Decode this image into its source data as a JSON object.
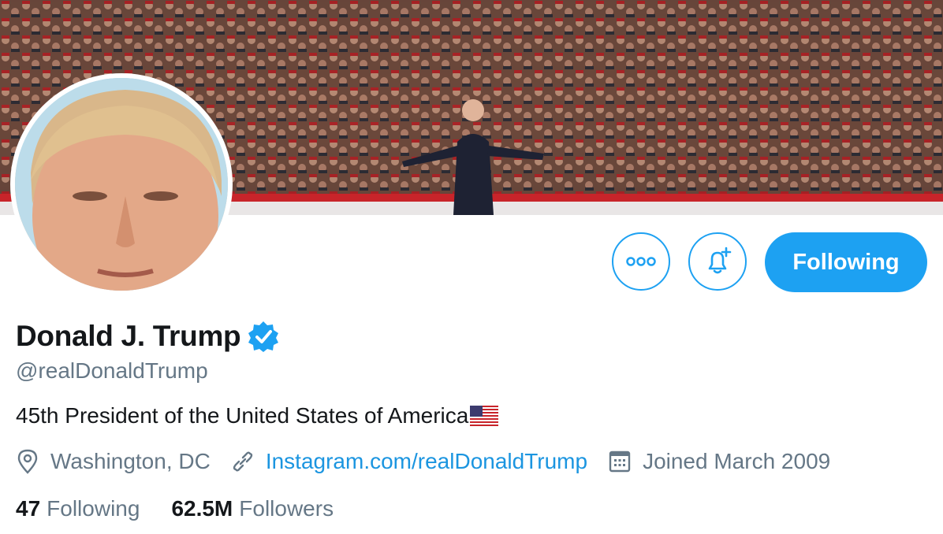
{
  "profile": {
    "name": "Donald J. Trump",
    "handle": "@realDonaldTrump",
    "bio": "45th President of the United States of America",
    "location": "Washington, DC",
    "website": "Instagram.com/realDonaldTrump",
    "joined": "Joined March 2009",
    "following_count": "47",
    "following_label": "Following",
    "followers_count": "62.5M",
    "followers_label": "Followers"
  },
  "actions": {
    "follow_label": "Following"
  },
  "icons": {
    "more": "more-horizontal-icon",
    "bell": "notification-bell-plus-icon",
    "verified": "verified-badge-icon",
    "flag": "us-flag-emoji",
    "location": "location-pin-icon",
    "link": "link-icon",
    "calendar": "calendar-icon"
  },
  "colors": {
    "accent": "#1da1f2",
    "link": "#1b95e0",
    "secondary_text": "#657786",
    "primary_text": "#14171a"
  }
}
